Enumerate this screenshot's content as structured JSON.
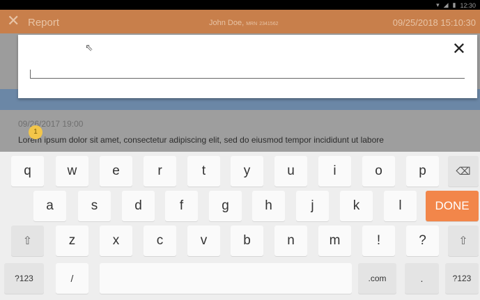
{
  "status_bar": {
    "time": "12:30"
  },
  "header": {
    "title": "Report",
    "patient_name": "John Doe,",
    "mrn_label": "MRN",
    "mrn": "2341562",
    "date": "09/25/2018 15:10:30"
  },
  "dialog": {
    "input_value": ""
  },
  "note": {
    "date": "09/26/2017 19:00",
    "text": "Lorem ipsum dolor sit amet, consectetur adipiscing elit, sed do eiusmod tempor incididunt ut labore",
    "badge": "1"
  },
  "keyboard": {
    "row1": [
      "q",
      "w",
      "e",
      "r",
      "t",
      "y",
      "u",
      "i",
      "o",
      "p"
    ],
    "row2": [
      "a",
      "s",
      "d",
      "f",
      "g",
      "h",
      "j",
      "k",
      "l"
    ],
    "row3": [
      "z",
      "x",
      "c",
      "v",
      "b",
      "n",
      "m",
      "!",
      "?"
    ],
    "done_label": "DONE",
    "symbols_label": "?123",
    "slash_label": "/",
    "dotcom_label": ".com",
    "period_label": ".",
    "symbols_label_right": "?123"
  },
  "icons": {
    "close": "close-icon",
    "backspace": "backspace-icon",
    "shift": "shift-icon",
    "wifi": "wifi-icon",
    "battery": "battery-icon"
  },
  "colors": {
    "header": "#c87f4b",
    "done": "#f2864a"
  }
}
